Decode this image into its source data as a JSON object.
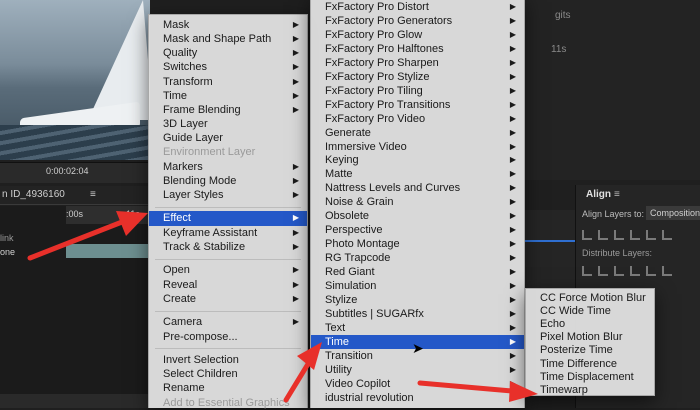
{
  "background": {
    "timecode": "0:00:02:04",
    "comp_tab_label": "n ID_4936160",
    "comp_tab_icon": "menu-lines-icon",
    "timeline_ruler_start": ":00s",
    "timeline_ruler_end": "11s",
    "layer_label_1": "link",
    "layer_label_2": "one",
    "right_digits": "gits",
    "right_time": "11s",
    "align_panel": {
      "title": "Align",
      "align_to_label": "Align Layers to:",
      "align_to_value": "Composition",
      "distribute_label": "Distribute Layers:"
    }
  },
  "main_menu": {
    "items": [
      {
        "label": "Mask",
        "submenu": true
      },
      {
        "label": "Mask and Shape Path",
        "submenu": true
      },
      {
        "label": "Quality",
        "submenu": true
      },
      {
        "label": "Switches",
        "submenu": true
      },
      {
        "label": "Transform",
        "submenu": true
      },
      {
        "label": "Time",
        "submenu": true
      },
      {
        "label": "Frame Blending",
        "submenu": true
      },
      {
        "label": "3D Layer",
        "submenu": false
      },
      {
        "label": "Guide Layer",
        "submenu": false
      },
      {
        "label": "Environment Layer",
        "submenu": false,
        "disabled": true
      },
      {
        "label": "Markers",
        "submenu": true
      },
      {
        "label": "Blending Mode",
        "submenu": true
      },
      {
        "label": "Layer Styles",
        "submenu": true
      },
      {
        "separator": true
      },
      {
        "label": "Effect",
        "submenu": true,
        "selected": true
      },
      {
        "label": "Keyframe Assistant",
        "submenu": true
      },
      {
        "label": "Track & Stabilize",
        "submenu": true
      },
      {
        "separator": true
      },
      {
        "label": "Open",
        "submenu": true
      },
      {
        "label": "Reveal",
        "submenu": true
      },
      {
        "label": "Create",
        "submenu": true
      },
      {
        "separator": true
      },
      {
        "label": "Camera",
        "submenu": true
      },
      {
        "label": "Pre-compose...",
        "submenu": false
      },
      {
        "separator": true
      },
      {
        "label": "Invert Selection",
        "submenu": false
      },
      {
        "label": "Select Children",
        "submenu": false
      },
      {
        "label": "Rename",
        "submenu": false
      },
      {
        "label": "Add to Essential Graphics",
        "submenu": false,
        "disabled": true
      }
    ]
  },
  "effect_menu": {
    "items": [
      {
        "label": "FxFactory Pro Distort",
        "submenu": true
      },
      {
        "label": "FxFactory Pro Generators",
        "submenu": true
      },
      {
        "label": "FxFactory Pro Glow",
        "submenu": true
      },
      {
        "label": "FxFactory Pro Halftones",
        "submenu": true
      },
      {
        "label": "FxFactory Pro Sharpen",
        "submenu": true
      },
      {
        "label": "FxFactory Pro Stylize",
        "submenu": true
      },
      {
        "label": "FxFactory Pro Tiling",
        "submenu": true
      },
      {
        "label": "FxFactory Pro Transitions",
        "submenu": true
      },
      {
        "label": "FxFactory Pro Video",
        "submenu": true
      },
      {
        "label": "Generate",
        "submenu": true
      },
      {
        "label": "Immersive Video",
        "submenu": true
      },
      {
        "label": "Keying",
        "submenu": true
      },
      {
        "label": "Matte",
        "submenu": true
      },
      {
        "label": "Nattress Levels and Curves",
        "submenu": true
      },
      {
        "label": "Noise & Grain",
        "submenu": true
      },
      {
        "label": "Obsolete",
        "submenu": true
      },
      {
        "label": "Perspective",
        "submenu": true
      },
      {
        "label": "Photo Montage",
        "submenu": true
      },
      {
        "label": "RG Trapcode",
        "submenu": true
      },
      {
        "label": "Red Giant",
        "submenu": true
      },
      {
        "label": "Simulation",
        "submenu": true
      },
      {
        "label": "Stylize",
        "submenu": true
      },
      {
        "label": "Subtitles | SUGARfx",
        "submenu": true
      },
      {
        "label": "Text",
        "submenu": true
      },
      {
        "label": "Time",
        "submenu": true,
        "selected": true
      },
      {
        "label": "Transition",
        "submenu": true
      },
      {
        "label": "Utility",
        "submenu": true
      },
      {
        "label": "Video Copilot",
        "submenu": true
      },
      {
        "label": "idustrial revolution",
        "submenu": true
      }
    ]
  },
  "time_menu": {
    "items": [
      {
        "label": "CC Force Motion Blur"
      },
      {
        "label": "CC Wide Time"
      },
      {
        "label": "Echo"
      },
      {
        "label": "Pixel Motion Blur"
      },
      {
        "label": "Posterize Time"
      },
      {
        "label": "Time Difference"
      },
      {
        "label": "Time Displacement"
      },
      {
        "label": "Timewarp"
      }
    ]
  },
  "colors": {
    "selection": "#2458c8",
    "menu_bg": "#dedede",
    "annotation_arrow": "#e8302a"
  },
  "icons": {
    "submenu": "chevron-right-icon",
    "cursor": "mouse-pointer-icon"
  }
}
